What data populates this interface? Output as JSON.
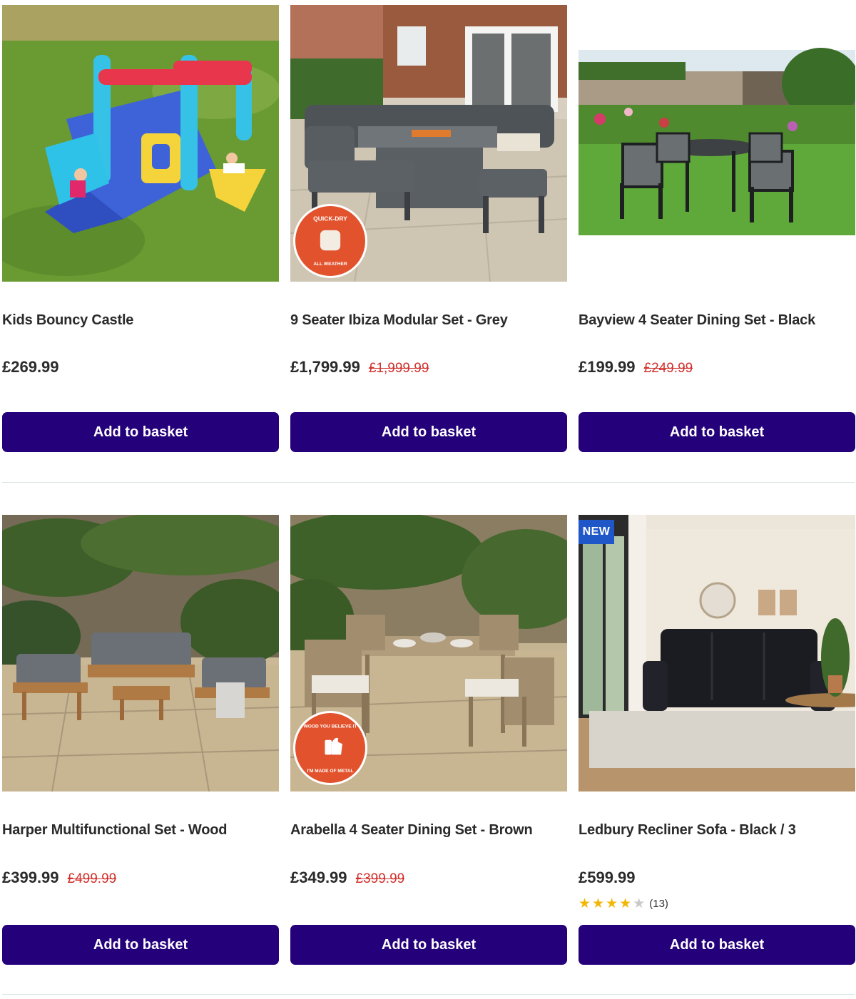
{
  "colors": {
    "button": "#24007a",
    "was_price": "#d0312d",
    "badge_new": "#1f57c8",
    "star_on": "#f2b705",
    "star_off": "#c9c9c9",
    "roundel": "#e2532d"
  },
  "products": [
    {
      "title": "Kids Bouncy Castle",
      "price": "£269.99",
      "was_price": "",
      "button_label": "Add to basket",
      "image": "bouncy-castle-image"
    },
    {
      "title": "9 Seater Ibiza Modular Set - Grey",
      "price": "£1,799.99",
      "was_price": "£1,999.99",
      "button_label": "Add to basket",
      "image": "modular-set-image",
      "roundel_text": "QUICK-DRY · ALL WEATHER CUSHIONS"
    },
    {
      "title": "Bayview 4 Seater Dining Set - Black",
      "price": "£199.99",
      "was_price": "£249.99",
      "button_label": "Add to basket",
      "image": "dining-set-image"
    },
    {
      "title": "Harper Multifunctional Set - Wood",
      "price": "£399.99",
      "was_price": "£499.99",
      "button_label": "Add to basket",
      "image": "wooden-set-image"
    },
    {
      "title": "Arabella 4 Seater Dining Set - Brown",
      "price": "£349.99",
      "was_price": "£399.99",
      "button_label": "Add to basket",
      "image": "arabella-set-image",
      "roundel_text": "WOOD YOU BELIEVE IT · I'M MADE OF METAL"
    },
    {
      "title": "Ledbury Recliner Sofa - Black / 3",
      "price": "£599.99",
      "was_price": "",
      "button_label": "Add to basket",
      "image": "recliner-sofa-image",
      "badge": "NEW",
      "rating": {
        "value": 4,
        "max": 5,
        "count": "(13)"
      }
    }
  ]
}
